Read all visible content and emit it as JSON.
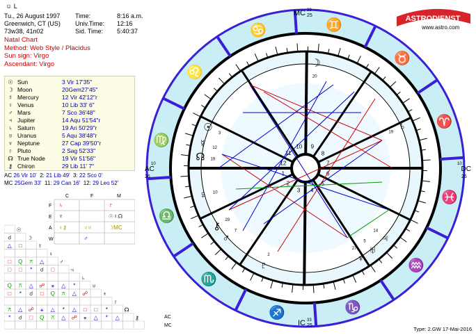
{
  "header": {
    "name": "L",
    "date_line": "Tu., 26 August 1997",
    "place_line": "Greenwich, CT (US)",
    "coord_line": "73w38, 41n02",
    "time_label": "Time:",
    "time_value": "8:16 a.m.",
    "univ_label": "Univ.Time:",
    "univ_value": "12:16",
    "sid_label": "Sid. Time:",
    "sid_value": "5:40:37"
  },
  "chart_info": {
    "line1": "Natal Chart",
    "line2": "Method: Web Style / Placidus",
    "line3": "Sun sign: Virgo",
    "line4": "Ascendant: Virgo"
  },
  "planets": [
    {
      "glyph": "☉",
      "name": "Sun",
      "pos": "3  Vir 17'35\""
    },
    {
      "glyph": "☽",
      "name": "Moon",
      "pos": "20Gem27'45\""
    },
    {
      "glyph": "☿",
      "name": "Mercury",
      "pos": "12  Vir 42'12\"r"
    },
    {
      "glyph": "♀",
      "name": "Venus",
      "pos": "10  Lib  33'  6\""
    },
    {
      "glyph": "♂",
      "name": "Mars",
      "pos": "7  Sco 36'48\""
    },
    {
      "glyph": "♃",
      "name": "Jupiter",
      "pos": "14 Aqu 51'54\"r"
    },
    {
      "glyph": "♄",
      "name": "Saturn",
      "pos": "19  Ari  50'29\"r"
    },
    {
      "glyph": "♅",
      "name": "Uranus",
      "pos": "5 Aqu 38'48\"r"
    },
    {
      "glyph": "♆",
      "name": "Neptune",
      "pos": "27 Cap 39'50\"r"
    },
    {
      "glyph": "♇",
      "name": "Pluto",
      "pos": "2  Sag 52'33\""
    },
    {
      "glyph": "☊",
      "name": "True Node",
      "pos": "19  Vir 51'56\""
    },
    {
      "glyph": "⚷",
      "name": "Chiron",
      "pos": "29  Lib 11'  7\""
    }
  ],
  "houses": {
    "row1": {
      "ac": "AC",
      "ac_v": "26  Vir  10'",
      "h2": "2:",
      "h2_v": "21  Lib  49'",
      "h3": "3:",
      "h3_v": "22 Sco   0'"
    },
    "row2": {
      "mc": "MC",
      "mc_v": "25Gem 33'",
      "h11": "11:",
      "h11_v": "29 Can 16'",
      "h12": "12:",
      "h12_v": "29 Leo  52'"
    }
  },
  "elements": {
    "headers": [
      "C",
      "F",
      "M"
    ],
    "rows": [
      "F",
      "E",
      "A",
      "W"
    ]
  },
  "aspect_labels": [
    "AC",
    "MC"
  ],
  "wheel": {
    "mc_label": "MC",
    "mc_sub": "25",
    "mc_sup": "33",
    "ic_label": "IC",
    "ic_sub": "25",
    "ic_sup": "33",
    "ac_label": "AC",
    "ac_sub": "26",
    "ac_sup": "10",
    "dc_label": "DC",
    "dc_sub": "26",
    "dc_sup": "10",
    "house_numbers": [
      "1",
      "2",
      "3",
      "4",
      "5",
      "6",
      "7",
      "8",
      "9",
      "10",
      "11",
      "12"
    ]
  },
  "logo": {
    "title": "ASTRODIENST",
    "url": "www.astro.com"
  },
  "footer": "Type: 2.GW  17-Mai-2016",
  "colors": {
    "ring": "#3a1fd6",
    "fire": "#cc0000",
    "water": "#0000cc",
    "air": "#999900",
    "earth": "#333333"
  }
}
